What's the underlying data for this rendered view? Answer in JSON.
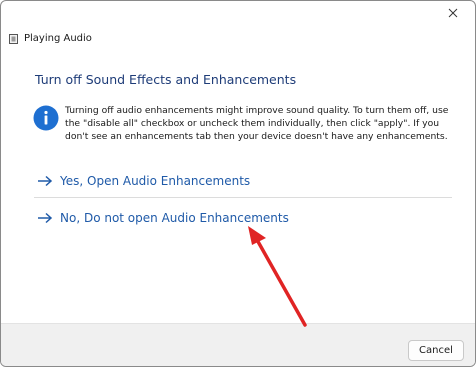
{
  "window": {
    "title": "Playing Audio",
    "title_icon": "speaker-app-icon",
    "close_icon": "close-icon",
    "close_label": "✕"
  },
  "main": {
    "heading": "Turn off Sound Effects and Enhancements",
    "info_icon": "info-icon",
    "info_text": "Turning off audio enhancements might improve sound quality. To turn them off, use the \"disable all\" checkbox or uncheck them individually, then click \"apply\". If you don't see an enhancements tab then your device doesn't have any enhancements.",
    "options": [
      {
        "label": "Yes, Open Audio Enhancements",
        "icon": "arrow-right-icon"
      },
      {
        "label": "No, Do not open Audio Enhancements",
        "icon": "arrow-right-icon"
      }
    ]
  },
  "footer": {
    "cancel_label": "Cancel"
  },
  "colors": {
    "heading": "#1e3c78",
    "link": "#1f5aa8",
    "info_icon": "#1e6fd1",
    "annotation_arrow": "#e02424"
  }
}
